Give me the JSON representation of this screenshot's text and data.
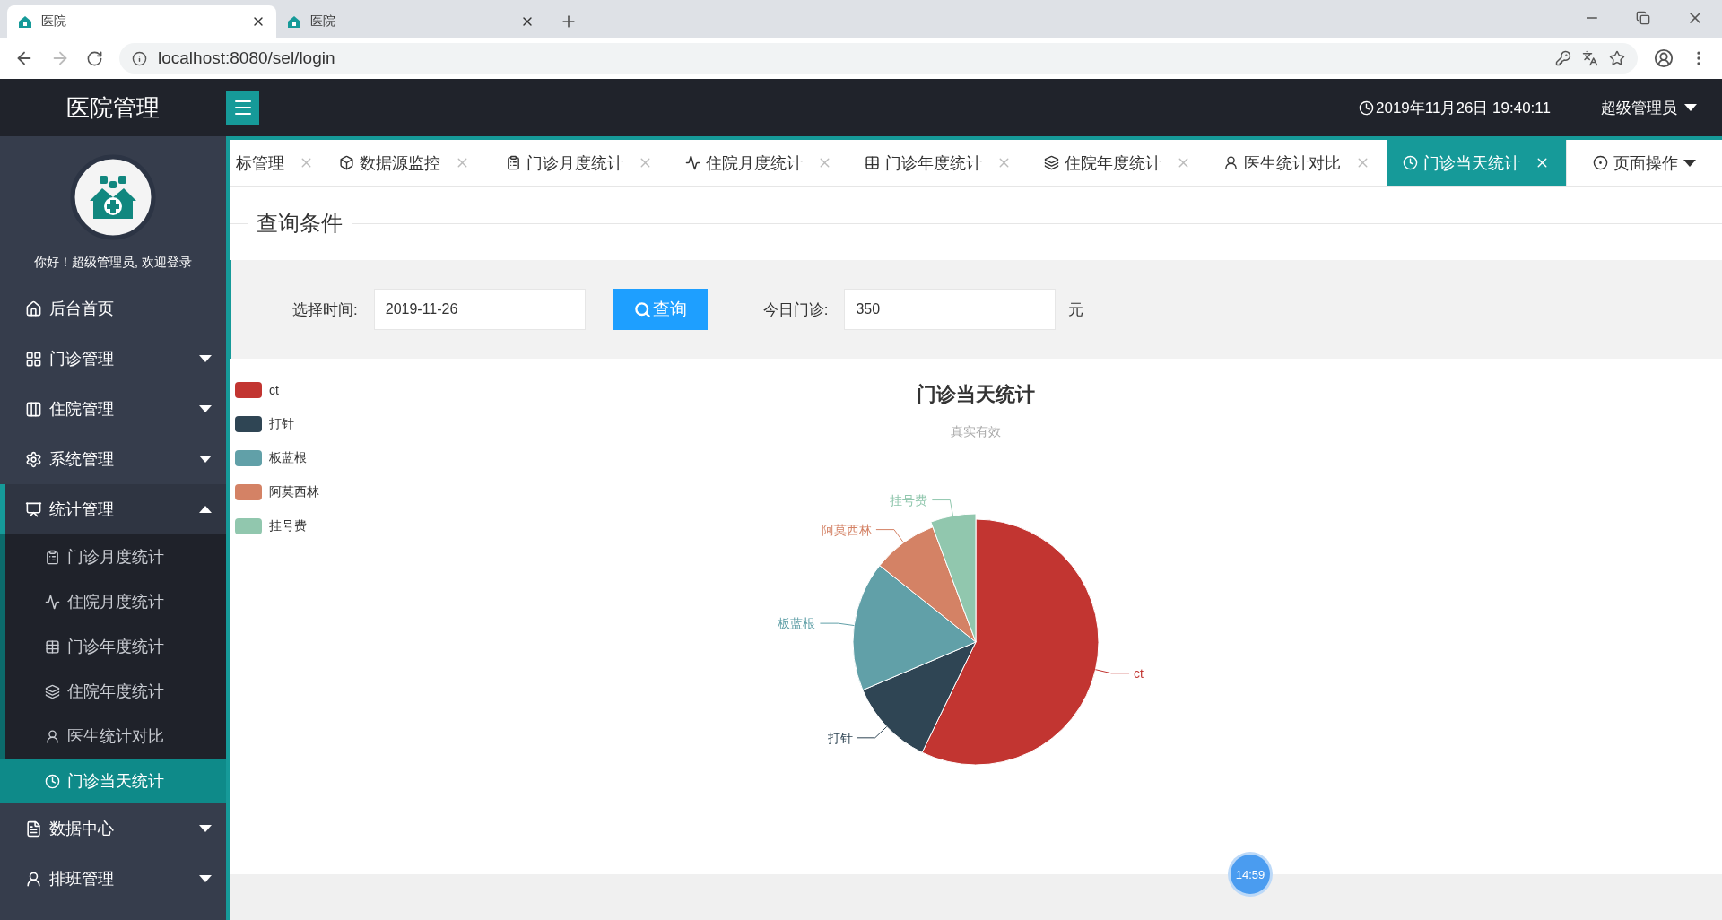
{
  "browser": {
    "tabs": [
      {
        "title": "医院",
        "selected": true
      },
      {
        "title": "医院",
        "selected": false
      }
    ],
    "url": "localhost:8080/sel/login"
  },
  "header": {
    "brand": "医院管理",
    "datetime": "2019年11月26日 19:40:11",
    "user": "超级管理员"
  },
  "sidebar": {
    "greeting": "你好！超级管理员, 欢迎登录",
    "items": [
      {
        "label": "后台首页"
      },
      {
        "label": "门诊管理",
        "expanded": false
      },
      {
        "label": "住院管理",
        "expanded": false
      },
      {
        "label": "系统管理",
        "expanded": false
      },
      {
        "label": "统计管理",
        "expanded": true,
        "children": [
          {
            "label": "门诊月度统计",
            "selected": false
          },
          {
            "label": "住院月度统计",
            "selected": false
          },
          {
            "label": "门诊年度统计",
            "selected": false
          },
          {
            "label": "住院年度统计",
            "selected": false
          },
          {
            "label": "医生统计对比",
            "selected": false
          },
          {
            "label": "门诊当天统计",
            "selected": true
          }
        ]
      },
      {
        "label": "数据中心",
        "expanded": false
      },
      {
        "label": "排班管理",
        "expanded": false
      }
    ]
  },
  "tabs": [
    {
      "label": "标管理",
      "selected": false
    },
    {
      "label": "数据源监控",
      "selected": false
    },
    {
      "label": "门诊月度统计",
      "selected": false
    },
    {
      "label": "住院月度统计",
      "selected": false
    },
    {
      "label": "门诊年度统计",
      "selected": false
    },
    {
      "label": "住院年度统计",
      "selected": false
    },
    {
      "label": "医生统计对比",
      "selected": false
    },
    {
      "label": "门诊当天统计",
      "selected": true
    }
  ],
  "page_ops": "页面操作",
  "query": {
    "legend": "查询条件",
    "date_label": "选择时间:",
    "date_value": "2019-11-26",
    "button": "查询",
    "today_label": "今日门诊:",
    "today_value": "350",
    "unit": "元"
  },
  "chart": {
    "subtitle": "真实有效",
    "legend": [
      {
        "label": "ct",
        "color": "#c23531"
      },
      {
        "label": "打针",
        "color": "#2f4554"
      },
      {
        "label": "板蓝根",
        "color": "#61a0a8"
      },
      {
        "label": "阿莫西林",
        "color": "#d48265"
      },
      {
        "label": "挂号费",
        "color": "#91c7ae"
      }
    ],
    "chart_data": {
      "type": "pie",
      "title": "门诊当天统计",
      "categories": [
        "ct",
        "打针",
        "板蓝根",
        "阿莫西林",
        "挂号费"
      ],
      "values": [
        57.2,
        11.4,
        17.1,
        8.6,
        5.7
      ]
    }
  },
  "timer_badge": "14:59"
}
